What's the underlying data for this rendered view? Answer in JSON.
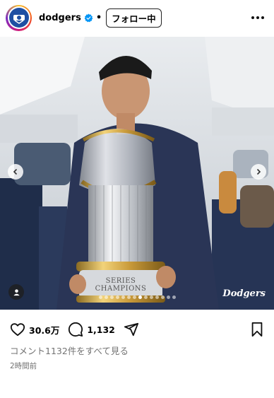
{
  "post": {
    "username": "dodgers",
    "separator": "•",
    "follow_label": "フォロー中",
    "image_caption_text": "SERIES CHAMPIONS",
    "watermark": "Dodgers",
    "carousel": {
      "count": 14,
      "active_index": 7
    }
  },
  "actions": {
    "likes": "30.6万",
    "comments": "1,132"
  },
  "view_comments_label": "コメント1132件をすべて見る",
  "time_ago": "2時間前",
  "colors": {
    "avatar_blue": "#1e4fa3",
    "verified_blue": "#0095f6",
    "hoodie_navy": "#2a3556",
    "muted_text": "#737373"
  },
  "icons": [
    "avatar-logo-icon",
    "verified-icon",
    "more-icon",
    "chevron-left-icon",
    "chevron-right-icon",
    "user-tag-icon",
    "heart-icon",
    "comment-icon",
    "share-icon",
    "bookmark-icon"
  ]
}
